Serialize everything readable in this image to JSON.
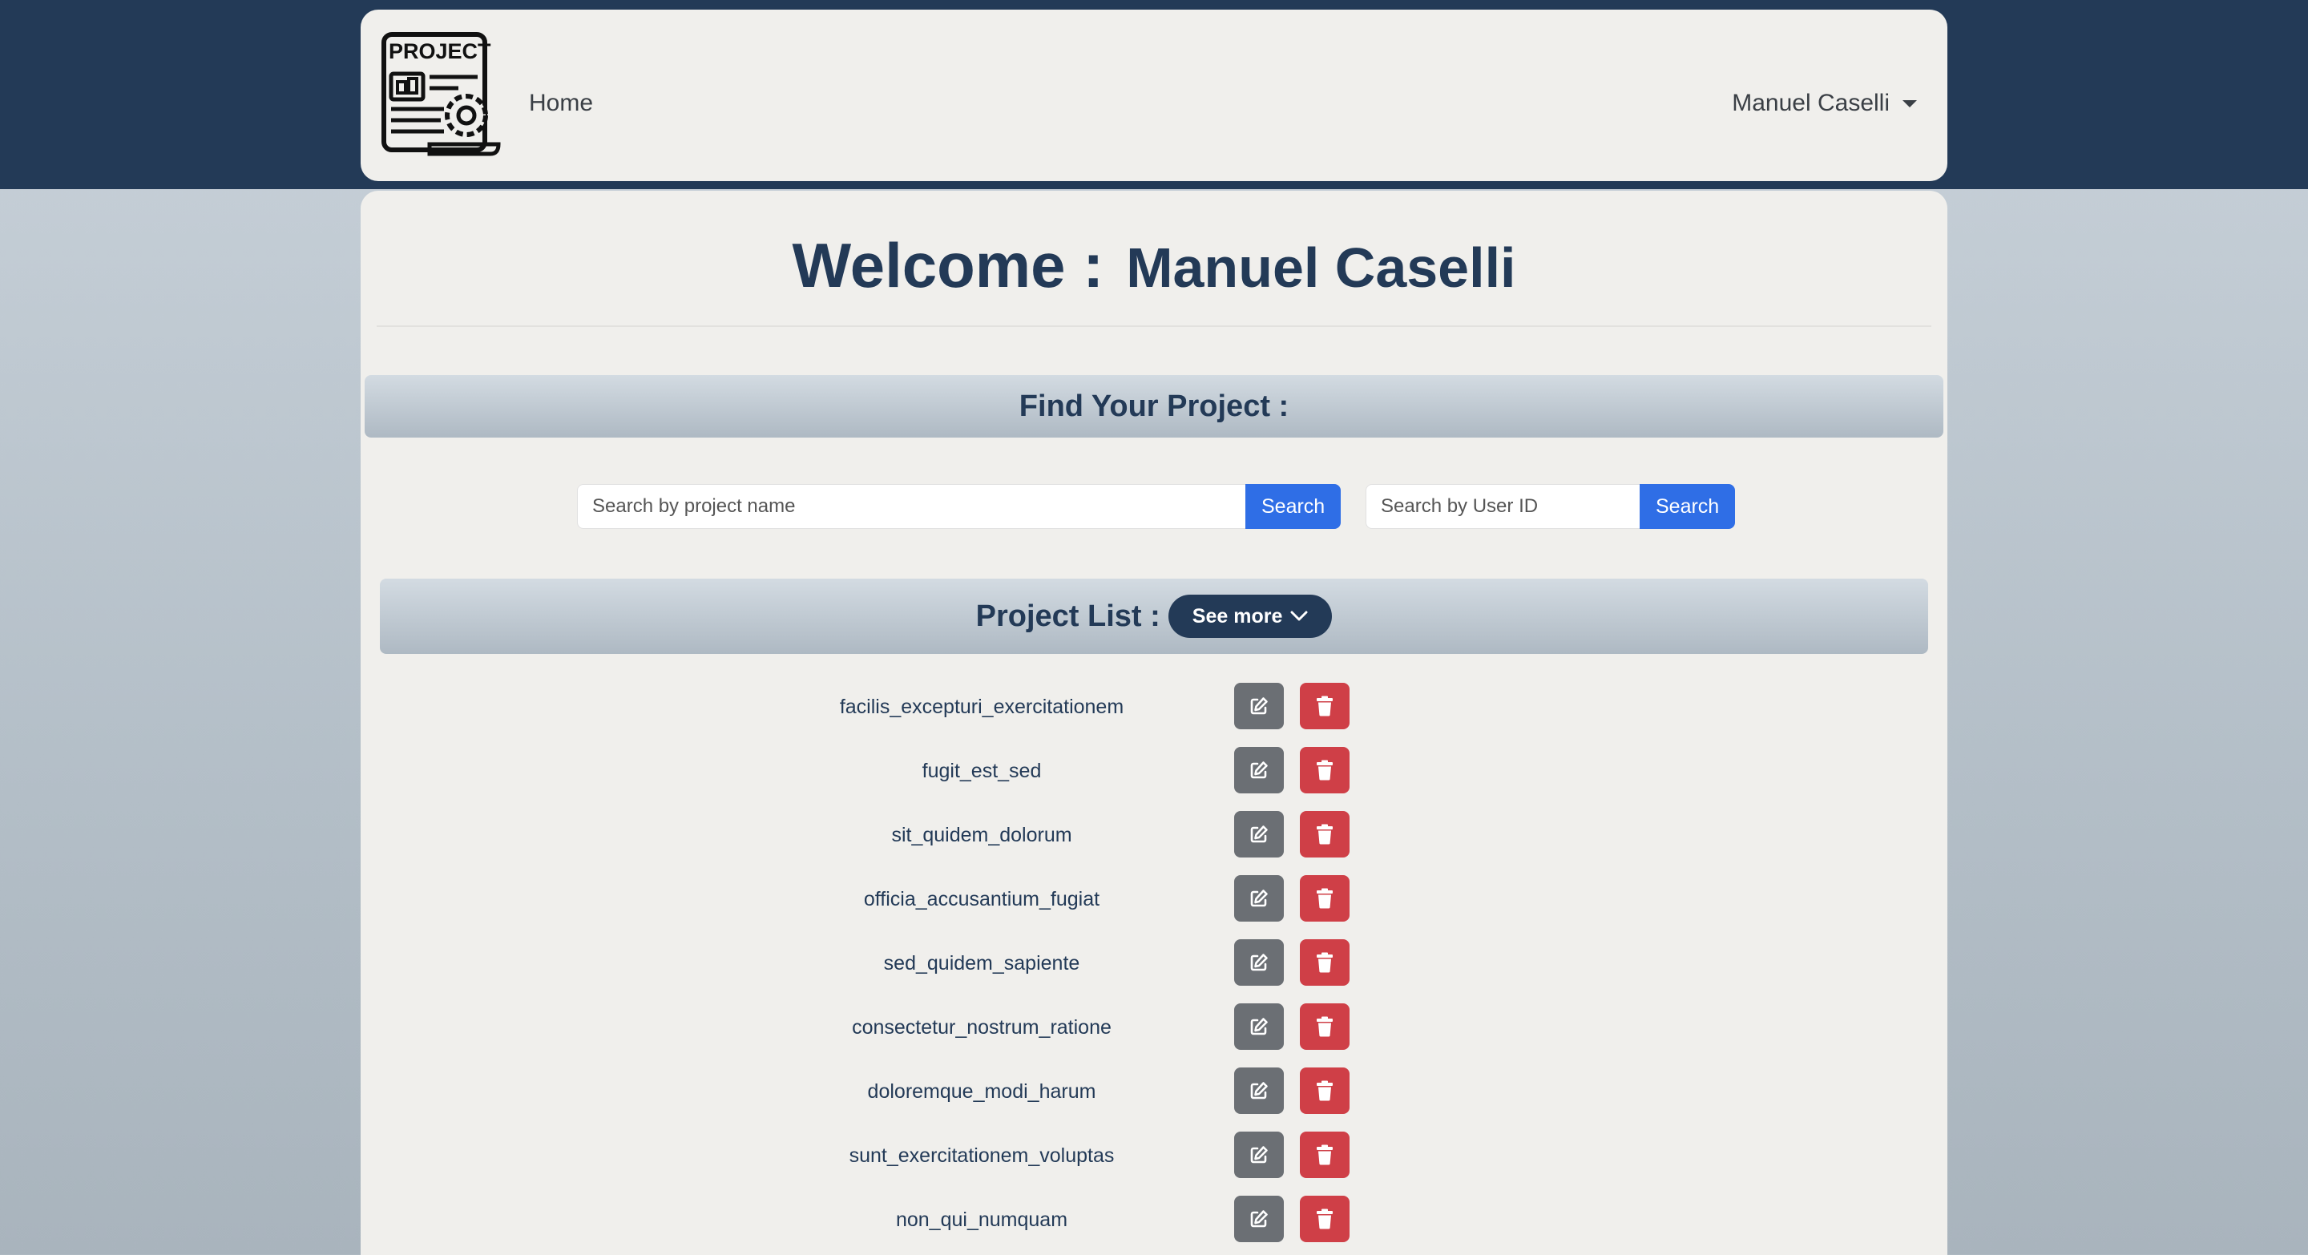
{
  "navbar": {
    "logo_text": "PROJECT",
    "home_label": "Home",
    "user_name": "Manuel Caselli"
  },
  "welcome": {
    "label": "Welcome :",
    "name": "Manuel Caselli"
  },
  "find": {
    "title": "Find Your Project :"
  },
  "search": {
    "project_placeholder": "Search by project name",
    "project_button": "Search",
    "user_placeholder": "Search by User ID",
    "user_button": "Search"
  },
  "project_list": {
    "title": "Project List :",
    "see_more_label": "See more",
    "items": [
      "facilis_excepturi_exercitationem",
      "fugit_est_sed",
      "sit_quidem_dolorum",
      "officia_accusantium_fugiat",
      "sed_quidem_sapiente",
      "consectetur_nostrum_ratione",
      "doloremque_modi_harum",
      "sunt_exercitationem_voluptas",
      "non_qui_numquam"
    ]
  },
  "colors": {
    "navy": "#233a57",
    "search_blue": "#2f6ee6",
    "edit_gray": "#6b6f74",
    "delete_red": "#cf3f47"
  },
  "icons": {
    "dropdown": "caret-down-icon",
    "see_more": "chevron-down-icon",
    "edit": "edit-icon",
    "delete": "trash-icon"
  }
}
